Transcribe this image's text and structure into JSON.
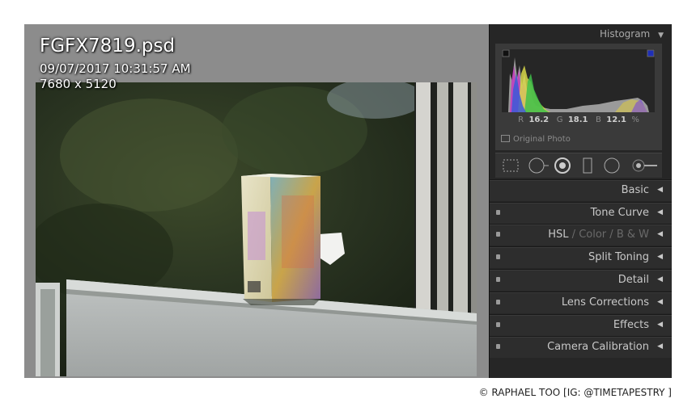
{
  "image": {
    "filename": "FGFX7819.psd",
    "datetime": "09/07/2017 10:31:57 AM",
    "dimensions": "7680 x 5120"
  },
  "histogram": {
    "title": "Histogram",
    "r_label": "R",
    "r_value": "16.2",
    "g_label": "G",
    "g_value": "18.1",
    "b_label": "B",
    "b_value": "12.1",
    "percent": "%",
    "original_photo": "Original Photo"
  },
  "sections": {
    "basic": "Basic",
    "tone_curve": "Tone Curve",
    "hsl": "HSL",
    "sep1": "/",
    "color": "Color",
    "sep2": "/",
    "bw": "B & W",
    "split_toning": "Split Toning",
    "detail": "Detail",
    "lens_corrections": "Lens Corrections",
    "effects": "Effects",
    "camera_calibration": "Camera Calibration"
  },
  "credit": "© RAPHAEL TOO [IG: @TIMETAPESTRY ]",
  "colors": {
    "panel_bg": "#262626",
    "canvas_bg": "#8c8c8c",
    "panel_text": "#c8c8c8"
  }
}
